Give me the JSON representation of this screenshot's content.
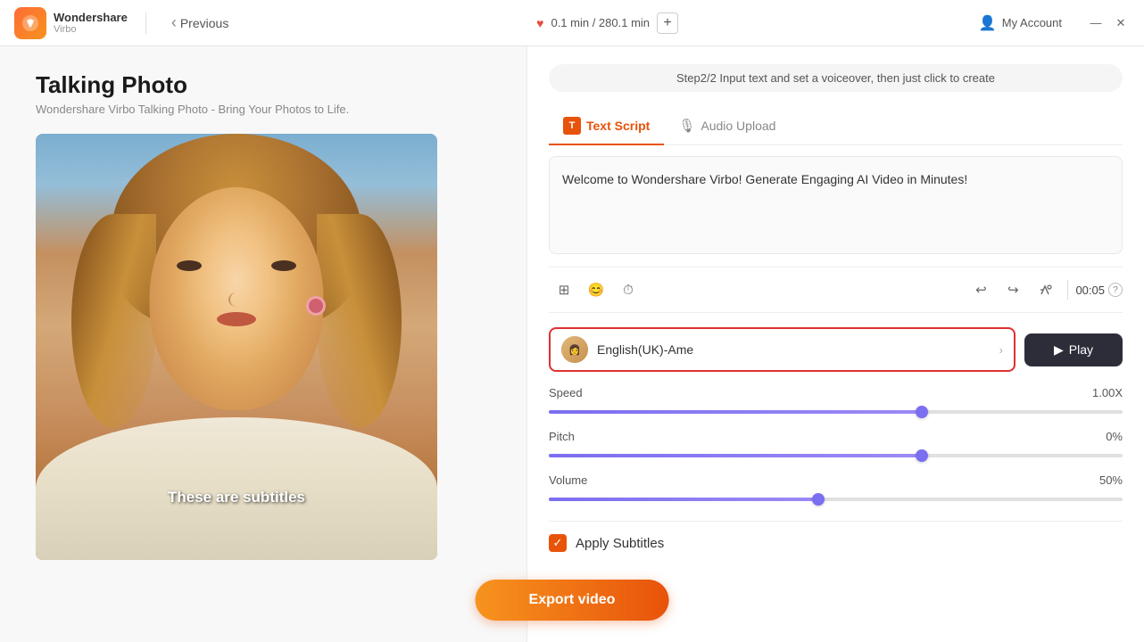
{
  "app": {
    "logo_name": "Wondershare",
    "logo_sub": "Virbo",
    "back_label": "Previous"
  },
  "header": {
    "duration": "0.1 min / 280.1 min",
    "account_label": "My Account"
  },
  "page": {
    "title": "Talking Photo",
    "subtitle": "Wondershare Virbo Talking Photo - Bring Your Photos to Life.",
    "step_hint": "Step2/2 Input text and set a voiceover, then just click to create"
  },
  "photo": {
    "subtitle_text": "These are subtitles"
  },
  "tabs": {
    "text_script_label": "Text Script",
    "audio_upload_label": "Audio Upload"
  },
  "editor": {
    "text_content": "Welcome to Wondershare Virbo! Generate Engaging AI Video in Minutes!",
    "time_display": "00:05"
  },
  "voice": {
    "name": "English(UK)-Ame",
    "play_label": "Play"
  },
  "speed": {
    "label": "Speed",
    "value": "1.00X",
    "percent": 65
  },
  "pitch": {
    "label": "Pitch",
    "value": "0%",
    "percent": 65
  },
  "volume": {
    "label": "Volume",
    "value": "50%",
    "percent": 47
  },
  "subtitles": {
    "label": "Apply Subtitles",
    "checked": true
  },
  "export": {
    "label": "Export video"
  },
  "icons": {
    "back_arrow": "‹",
    "heart": "♥",
    "add": "+",
    "minimize": "—",
    "close": "✕",
    "play": "▶",
    "undo": "↩",
    "redo": "↪",
    "tag": "🏷",
    "expand": "⊞",
    "voice_fx": "😊",
    "clock": "⏱",
    "help": "?",
    "chevron_right": "›",
    "check": "✓"
  }
}
